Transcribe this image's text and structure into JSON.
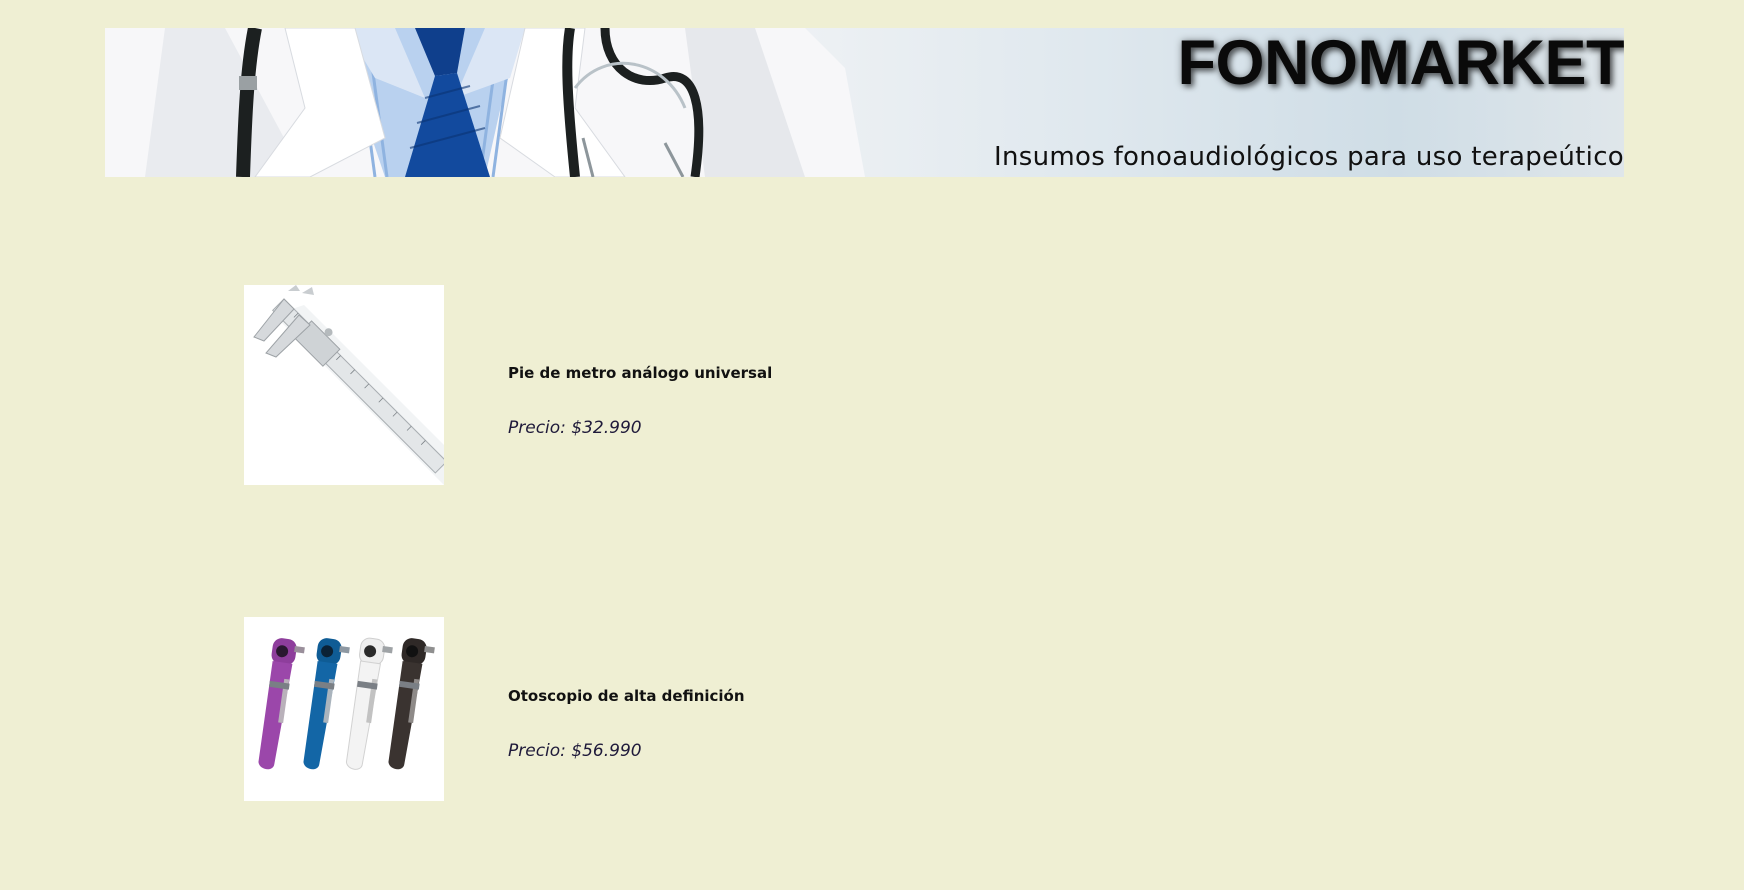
{
  "header": {
    "brand": "FONOMARKET",
    "tagline": "Insumos fonoaudiológicos para uso terapeútico"
  },
  "products": [
    {
      "name": "Pie de metro análogo universal",
      "price": "Precio: $32.990",
      "image": "caliper-image"
    },
    {
      "name": "Otoscopio de alta definición",
      "price": "Precio: $56.990",
      "image": "otoscopes-image",
      "colors": [
        "#8e3e9c",
        "#0f5c95",
        "#eeeeee",
        "#2f2927"
      ]
    }
  ],
  "colors": {
    "page_background": "#efefd3",
    "price_text": "#1f1a3a"
  }
}
